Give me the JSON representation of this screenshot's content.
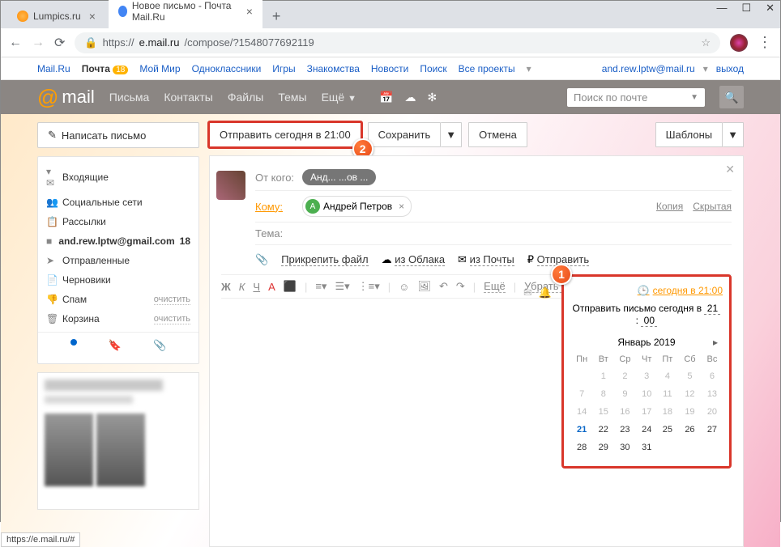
{
  "window": {
    "min": "—",
    "max": "☐",
    "close": "✕"
  },
  "tabs": [
    {
      "title": "Lumpics.ru"
    },
    {
      "title": "Новое письмо - Почта Mail.Ru"
    }
  ],
  "url": {
    "scheme": "https://",
    "host": "e.mail.ru",
    "path": "/compose/?1548077692119"
  },
  "topnav": {
    "links": [
      "Mail.Ru",
      "Почта",
      "Мой Мир",
      "Одноклассники",
      "Игры",
      "Знакомства",
      "Новости",
      "Поиск",
      "Все проекты"
    ],
    "badge": "18",
    "email": "and.rew.lptw@mail.ru",
    "logout": "выход"
  },
  "mailbar": {
    "brand": "mail",
    "items": [
      "Письма",
      "Контакты",
      "Файлы",
      "Темы",
      "Ещё"
    ],
    "search_ph": "Поиск по почте"
  },
  "sidebar": {
    "compose": "Написать письмо",
    "folders": [
      {
        "icon": "✉",
        "label": "Входящие",
        "selected": true
      },
      {
        "icon": "👥",
        "label": "Социальные сети"
      },
      {
        "icon": "📋",
        "label": "Рассылки"
      },
      {
        "icon": "■",
        "label": "and.rew.lptw@gmail.com",
        "count": "18"
      },
      {
        "icon": "➤",
        "label": "Отправленные"
      },
      {
        "icon": "📄",
        "label": "Черновики"
      },
      {
        "icon": "👎",
        "label": "Спам",
        "clear": "очистить"
      },
      {
        "icon": "🗑",
        "label": "Корзина",
        "clear": "очистить"
      }
    ]
  },
  "actions": {
    "send": "Отправить сегодня в 21:00",
    "save": "Сохранить",
    "cancel": "Отмена",
    "templates": "Шаблоны"
  },
  "compose": {
    "from_lbl": "От кого:",
    "from_val": "Анд...     ...ов ...",
    "to_lbl": "Кому:",
    "to_chip": "Андрей Петров",
    "copy": "Копия",
    "bcc": "Скрытая",
    "subj_lbl": "Тема:",
    "sched_link": "сегодня в 21:00",
    "attach": {
      "file": "Прикрепить файл",
      "cloud": "из Облака",
      "mail": "из Почты",
      "send2": "Отправить"
    },
    "fmt_more": "Ещё",
    "fmt_clear": "Убрать офо"
  },
  "calendar": {
    "title_prefix": "Отправить письмо сегодня в ",
    "hh": "21",
    "mm": "00",
    "month": "Январь 2019",
    "dow": [
      "Пн",
      "Вт",
      "Ср",
      "Чт",
      "Пт",
      "Сб",
      "Вс"
    ],
    "weeks": [
      [
        "",
        "1",
        "2",
        "3",
        "4",
        "5",
        "6"
      ],
      [
        "7",
        "8",
        "9",
        "10",
        "11",
        "12",
        "13"
      ],
      [
        "14",
        "15",
        "16",
        "17",
        "18",
        "19",
        "20"
      ],
      [
        "21",
        "22",
        "23",
        "24",
        "25",
        "26",
        "27"
      ],
      [
        "28",
        "29",
        "30",
        "31",
        "",
        "",
        ""
      ]
    ],
    "today": "21",
    "muted_max": 20
  },
  "status": "https://e.mail.ru/#",
  "badges": {
    "one": "1",
    "two": "2"
  }
}
